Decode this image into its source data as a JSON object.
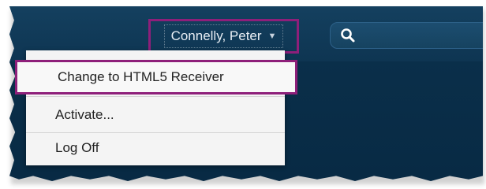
{
  "header": {
    "user_name": "Connelly, Peter",
    "user_caret": "▼",
    "search": {
      "placeholder": "",
      "value": ""
    }
  },
  "user_menu": {
    "items": [
      {
        "label": "Change to HTML5 Receiver",
        "highlighted": true
      },
      {
        "label": "Activate..."
      },
      {
        "label": "Log Off"
      }
    ]
  },
  "colors": {
    "background": "#0a2f4a",
    "highlight_border": "#8e1f7a",
    "menu_bg": "#f4f4f4",
    "text_light": "#e8eef4"
  },
  "icons": {
    "search": "search-icon",
    "caret": "chevron-down-icon"
  }
}
